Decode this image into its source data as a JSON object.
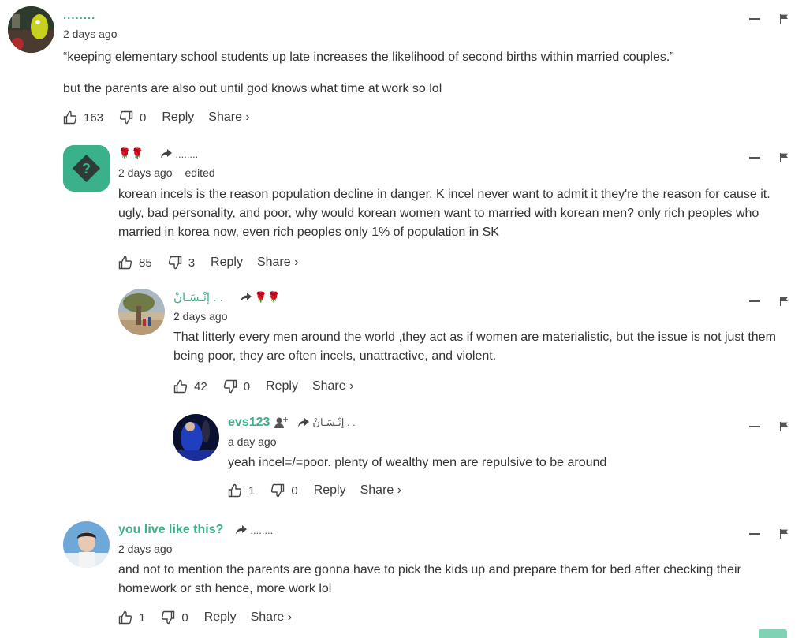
{
  "comments": [
    {
      "username": "........",
      "time": "2 days ago",
      "paragraphs": [
        "“keeping elementary school students up late increases the likelihood of second births within married couples.”",
        "but the parents are also out until god knows what time at work so lol"
      ],
      "likes": "163",
      "dislikes": "0",
      "reply_label": "Reply",
      "share_label": "Share ›"
    },
    {
      "username": "🌹🌹",
      "reply_to": "........",
      "time": "2 days ago",
      "edited": "edited",
      "text": "korean incels is the reason population decline in danger. K incel never want to admit it they're the reason for cause it. ugly, bad personality, and poor, why would korean women want to married with korean men? only rich peoples who married in korea now, even rich peoples only 1% of population in SK",
      "likes": "85",
      "dislikes": "3",
      "reply_label": "Reply",
      "share_label": "Share ›"
    },
    {
      "username": "إنْـسَـانْ . .",
      "reply_to": "🌹🌹",
      "time": "2 days ago",
      "text": "That litterly every men around the world ,they act as if women are materialistic, but the issue is not just them being poor, they are often incels, unattractive, and violent.",
      "likes": "42",
      "dislikes": "0",
      "reply_label": "Reply",
      "share_label": "Share ›"
    },
    {
      "username": "evs123",
      "reply_to": "إنْـسَـانْ . .",
      "time": "a day ago",
      "text": "yeah incel=/=poor. plenty of wealthy men are repulsive to be around",
      "likes": "1",
      "dislikes": "0",
      "reply_label": "Reply",
      "share_label": "Share ›"
    },
    {
      "username": "you live like this?",
      "reply_to": "........",
      "time": "2 days ago",
      "text": "and not to mention the parents are gonna have to pick the kids up and prepare them for bed after checking their homework or sth hence, more work lol",
      "likes": "1",
      "dislikes": "0",
      "reply_label": "Reply",
      "share_label": "Share ›"
    }
  ],
  "colors": {
    "accent": "#3ab08b",
    "text": "#333333",
    "muted": "#555555"
  }
}
